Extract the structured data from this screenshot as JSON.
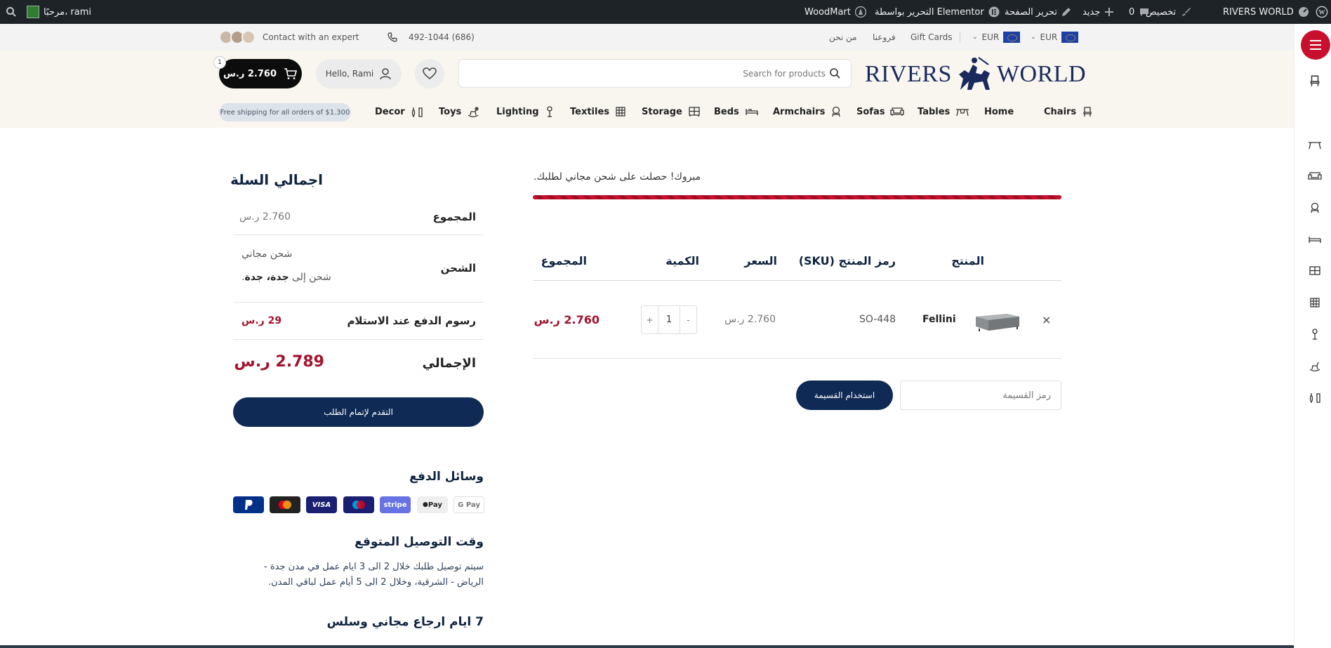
{
  "admin_bar": {
    "site_name": "RIVERS WORLD",
    "customize": "تخصيص",
    "comments_count": "0",
    "new": "جديد",
    "edit_page": "تحرير الصفحة",
    "edit_elementor": "التحرير بواسطة Elementor",
    "woodmart": "WoodMart",
    "greeting": "مرحبًا، rami"
  },
  "topbar": {
    "currency_1": "EUR",
    "currency_2": "EUR",
    "gift_cards": "Gift Cards",
    "branches": "فروعنا",
    "about": "من نحن",
    "phone": "492-1044 (686)",
    "contact_expert": "Contact with an expert"
  },
  "header": {
    "logo_left": "RIVERS",
    "logo_right": "WORLD",
    "search_placeholder": "Search for products",
    "hello": "Hello, Rami",
    "cart_total": "2.760 ر.س",
    "cart_count": "1"
  },
  "nav": {
    "items": [
      "Chairs",
      "Home",
      "Tables",
      "Sofas",
      "Armchairs",
      "Beds",
      "Storage",
      "Textiles",
      "Lighting",
      "Toys",
      "Decor"
    ],
    "shipping_note": "Free shipping for all orders of $1.300"
  },
  "cart": {
    "free_shipping_msg": "مبروك! حصلت على شحن مجاني لطلبك.",
    "progress": 1.0,
    "col_product": "المنتج",
    "col_sku": "رمز المنتج (SKU)",
    "col_price": "السعر",
    "col_qty": "الكمية",
    "col_subtotal": "المجموع",
    "row": {
      "remove": "×",
      "name": "Fellini",
      "sku": "SO-448",
      "price": "2.760 ر.س",
      "qty": "1",
      "plus": "+",
      "minus": "-",
      "subtotal": "2.760 ر.س"
    },
    "coupon_placeholder": "رمز القسيمة",
    "apply_coupon": "استخدام القسيمة"
  },
  "totals": {
    "title": "اجمالي السلة",
    "subtotal_label": "المجموع",
    "subtotal_value": "2.760 ر.س",
    "shipping_label": "الشحن",
    "shipping_free": "شحن مجاني",
    "shipping_to_prefix": "شحن إلى",
    "shipping_to_place": "جدة، جدة",
    "shipping_to_suffix": ".",
    "cod_label": "رسوم الدفع عند الاستلام",
    "cod_value": "29 ر.س",
    "total_label": "الإجمالي",
    "total_value": "2.789 ر.س",
    "checkout": "التقدم لإتمام الطلب"
  },
  "info": {
    "payment_title": "وسائل الدفع",
    "payment_methods": [
      "G Pay",
      "Pay",
      "stripe",
      "maestro",
      "VISA",
      "mastercard",
      "PayPal"
    ],
    "delivery_title": "وقت التوصيل المتوقع",
    "delivery_line1": "سيتم توصيل طلبك خلال 2 الى 3 ايام عمل في مدن جدة -",
    "delivery_line2": "الرياض - الشرقية، وخلال 2 الى 5 أيام عمل لباقي المدن.",
    "returns_title": "7 ايام ارجاع مجاني وسلس"
  },
  "colors": {
    "navy": "#0e2a55",
    "price_red": "#a3132e",
    "admin_bg": "#1d2327",
    "progress_red": "#c8102e"
  }
}
